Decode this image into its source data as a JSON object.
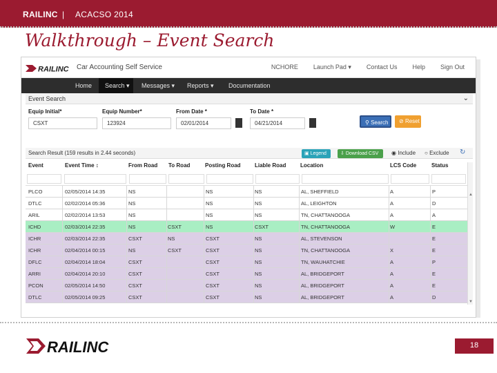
{
  "header": {
    "brand": "RAILINC",
    "separator": "|",
    "event": "ACACSO 2014"
  },
  "slide_title": "Walkthrough – Event Search",
  "app": {
    "logo_text": "RAILINC",
    "name": "Car Accounting Self Service",
    "top_links": [
      "NCHORE",
      "Launch Pad ▾",
      "Contact Us",
      "Help",
      "Sign Out"
    ],
    "nav": [
      "Home",
      "Search ▾",
      "Messages ▾",
      "Reports ▾",
      "Documentation"
    ],
    "active_nav_index": 1
  },
  "search_panel": {
    "title": "Event Search",
    "fields": [
      {
        "label": "Equip Initial*",
        "value": "CSXT"
      },
      {
        "label": "Equip Number*",
        "value": "123924"
      },
      {
        "label": "From Date *",
        "value": "02/01/2014"
      },
      {
        "label": "To Date *",
        "value": "04/21/2014"
      }
    ],
    "search_label": "Search",
    "reset_label": "Reset"
  },
  "results": {
    "summary": "Search Result (159 results in 2.44 seconds)",
    "legend_label": "Legend",
    "csv_label": "Download CSV",
    "include_label": "Include",
    "exclude_label": "Exclude",
    "columns": [
      "Event",
      "Event Time ↕",
      "From Road",
      "To Road",
      "Posting Road",
      "Liable Road",
      "Location",
      "LCS Code",
      "Status"
    ],
    "rows": [
      {
        "cells": [
          "PLCO",
          "02/05/2014 14:35",
          "NS",
          "",
          "NS",
          "NS",
          "AL, SHEFFIELD",
          "A",
          "P"
        ],
        "style": "white"
      },
      {
        "cells": [
          "DTLC",
          "02/02/2014 05:36",
          "NS",
          "",
          "NS",
          "NS",
          "AL, LEIGHTON",
          "A",
          "D"
        ],
        "style": "white"
      },
      {
        "cells": [
          "ARIL",
          "02/02/2014 13:53",
          "NS",
          "",
          "NS",
          "NS",
          "TN, CHATTANOOGA",
          "A",
          "A"
        ],
        "style": "white"
      },
      {
        "cells": [
          "ICHD",
          "02/03/2014 22:35",
          "NS",
          "CSXT",
          "NS",
          "CSXT",
          "TN, CHATTANOOGA",
          "W",
          "E"
        ],
        "style": "green"
      },
      {
        "cells": [
          "ICHR",
          "02/03/2014 22:35",
          "CSXT",
          "NS",
          "CSXT",
          "NS",
          "AL, STEVENSON",
          "",
          "E"
        ],
        "style": "purple"
      },
      {
        "cells": [
          "ICHR",
          "02/04/2014 00:15",
          "NS",
          "CSXT",
          "CSXT",
          "NS",
          "TN, CHATTANOOGA",
          "X",
          "E"
        ],
        "style": "purple"
      },
      {
        "cells": [
          "DFLC",
          "02/04/2014 18:04",
          "CSXT",
          "",
          "CSXT",
          "NS",
          "TN, WAUHATCHIE",
          "A",
          "P"
        ],
        "style": "purple"
      },
      {
        "cells": [
          "ARRI",
          "02/04/2014 20:10",
          "CSXT",
          "",
          "CSXT",
          "NS",
          "AL, BRIDGEPORT",
          "A",
          "E"
        ],
        "style": "purple"
      },
      {
        "cells": [
          "PCON",
          "02/05/2014 14:50",
          "CSXT",
          "",
          "CSXT",
          "NS",
          "AL, BRIDGEPORT",
          "A",
          "E"
        ],
        "style": "purple"
      },
      {
        "cells": [
          "DTLC",
          "02/05/2014 09:25",
          "CSXT",
          "",
          "CSXT",
          "NS",
          "AL, BRIDGEPORT",
          "A",
          "D"
        ],
        "style": "purple"
      }
    ]
  },
  "footer": {
    "logo_text": "RAILINC",
    "page_number": "18"
  },
  "colors": {
    "brand_red": "#9b1b30",
    "row_green": "#a9eec3",
    "row_purple": "#dccfe6",
    "nav_dark": "#2d2d2d"
  }
}
